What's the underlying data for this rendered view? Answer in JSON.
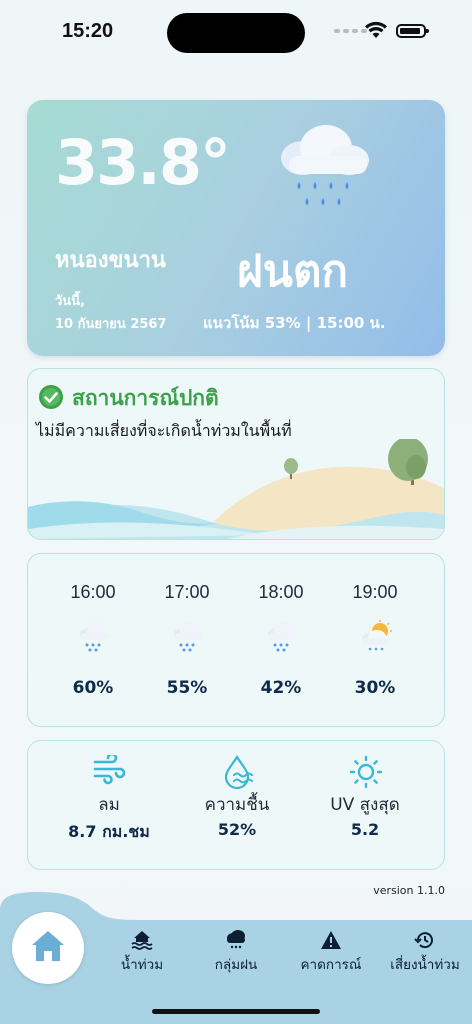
{
  "status_bar": {
    "time": "15:20"
  },
  "current": {
    "temperature": "33.8°",
    "province": "หนองขนาน",
    "date_label": "วันนี้,",
    "date": "10 กันยายน 2567",
    "condition": "ฝนตก",
    "trend": "แนวโน้ม 53% | 15:00 น."
  },
  "flood_status": {
    "title": "สถานการณ์ปกติ",
    "description": "ไม่มีความเสี่ยงที่จะเกิดน้ำท่วมในพื้นที่"
  },
  "hourly": [
    {
      "time": "16:00",
      "chance": "60%",
      "icon": "rain-cloud-icon"
    },
    {
      "time": "17:00",
      "chance": "55%",
      "icon": "rain-cloud-icon"
    },
    {
      "time": "18:00",
      "chance": "42%",
      "icon": "rain-cloud-icon"
    },
    {
      "time": "19:00",
      "chance": "30%",
      "icon": "sun-rain-cloud-icon"
    }
  ],
  "details": {
    "wind": {
      "label": "ลม",
      "value": "8.7 กม.ชม",
      "icon": "wind-icon"
    },
    "humidity": {
      "label": "ความชื้น",
      "value": "52%",
      "icon": "humidity-icon"
    },
    "uv": {
      "label": "UV สูงสุด",
      "value": "5.2",
      "icon": "sun-icon"
    }
  },
  "version": "version 1.1.0",
  "nav": {
    "home": {
      "icon": "home-icon"
    },
    "items": [
      {
        "label": "น้ำท่วม",
        "icon": "flood-icon"
      },
      {
        "label": "กลุ่มฝน",
        "icon": "rain-cloud-icon"
      },
      {
        "label": "คาดการณ์",
        "icon": "warning-icon"
      },
      {
        "label": "เสี่ยงน้ำท่วม",
        "icon": "history-icon"
      }
    ]
  },
  "colors": {
    "status_green": "#3ba14a",
    "nav_background": "#a9d2e4",
    "card_border": "#b7e3e0"
  }
}
